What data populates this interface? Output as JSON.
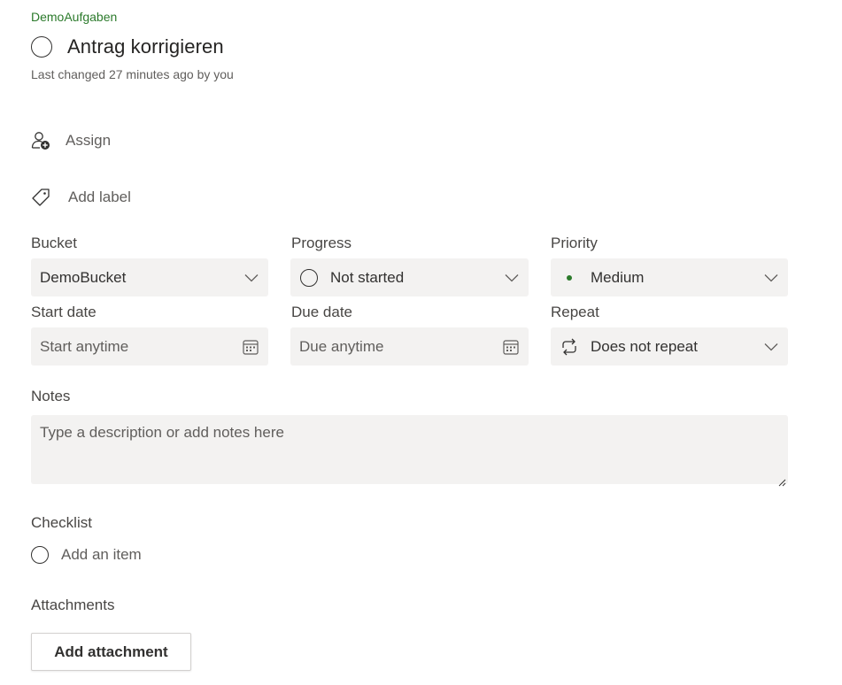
{
  "plan_name": "DemoAufgaben",
  "task": {
    "title": "Antrag korrigieren",
    "last_changed": "Last changed 27 minutes ago by you"
  },
  "actions": {
    "assign": "Assign",
    "add_label": "Add label"
  },
  "fields": {
    "bucket": {
      "label": "Bucket",
      "value": "DemoBucket"
    },
    "progress": {
      "label": "Progress",
      "value": "Not started"
    },
    "priority": {
      "label": "Priority",
      "value": "Medium",
      "color": "#2b7a2b"
    },
    "start_date": {
      "label": "Start date",
      "placeholder": "Start anytime"
    },
    "due_date": {
      "label": "Due date",
      "placeholder": "Due anytime"
    },
    "repeat": {
      "label": "Repeat",
      "value": "Does not repeat"
    }
  },
  "notes": {
    "label": "Notes",
    "placeholder": "Type a description or add notes here"
  },
  "checklist": {
    "label": "Checklist",
    "add_item": "Add an item"
  },
  "attachments": {
    "label": "Attachments",
    "add_button": "Add attachment"
  },
  "icons": {
    "complete": "circle-icon",
    "assign": "person-add-icon",
    "label": "tag-icon",
    "chevron": "chevron-down-icon",
    "calendar": "calendar-icon",
    "repeat": "repeat-icon"
  }
}
